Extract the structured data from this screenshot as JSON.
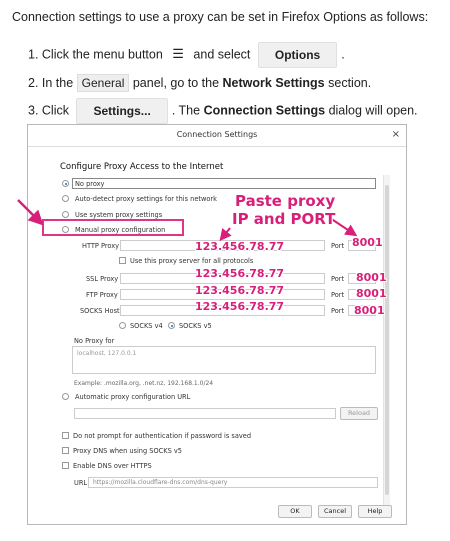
{
  "intro": "Connection settings to use a proxy can be set in Firefox Options as follows:",
  "steps": {
    "s1_pre": "1. Click the menu button",
    "s1_menu_glyph": "☰",
    "s1_mid": "and select",
    "s1_button": "Options",
    "s1_post": ".",
    "s2_pre": "2. In the",
    "s2_panel": "General",
    "s2_mid": "panel, go to the",
    "s2_bold": "Network Settings",
    "s2_post": "section.",
    "s3_pre": "3. Click",
    "s3_button": "Settings...",
    "s3_mid": ". The",
    "s3_bold": "Connection Settings",
    "s3_post": "dialog will open."
  },
  "dialog": {
    "title": "Connection Settings",
    "close": "×",
    "heading": "Configure Proxy Access to the Internet",
    "options": {
      "no_proxy": "No proxy",
      "auto_detect": "Auto-detect proxy settings for this network",
      "system": "Use system proxy settings",
      "manual": "Manual proxy configuration"
    },
    "http_proxy": "HTTP Proxy",
    "use_all": "Use this proxy server for all protocols",
    "ssl_proxy": "SSL Proxy",
    "ftp_proxy": "FTP Proxy",
    "socks_host": "SOCKS Host",
    "port": "Port",
    "socks_v4": "SOCKS v4",
    "socks_v5": "SOCKS v5",
    "no_proxy_for": "No Proxy for",
    "no_proxy_value": "localhost, 127.0.0.1",
    "example": "Example: .mozilla.org, .net.nz, 192.168.1.0/24",
    "auto_config": "Automatic proxy configuration URL",
    "reload": "Reload",
    "no_prompt": "Do not prompt for authentication if password is saved",
    "proxy_dns": "Proxy DNS when using SOCKS v5",
    "dns_https": "Enable DNS over HTTPS",
    "url_label": "URL",
    "url_value": "https://mozilla.cloudflare-dns.com/dns-query",
    "ok": "OK",
    "cancel": "Cancel",
    "help": "Help"
  },
  "annotations": {
    "paste_line1": "Paste proxy",
    "paste_line2": "IP and PORT",
    "ip": "123.456.78.77",
    "port": "8001"
  },
  "colors": {
    "annotation": "#d81f7a",
    "highlight_box": "#e0338a"
  }
}
